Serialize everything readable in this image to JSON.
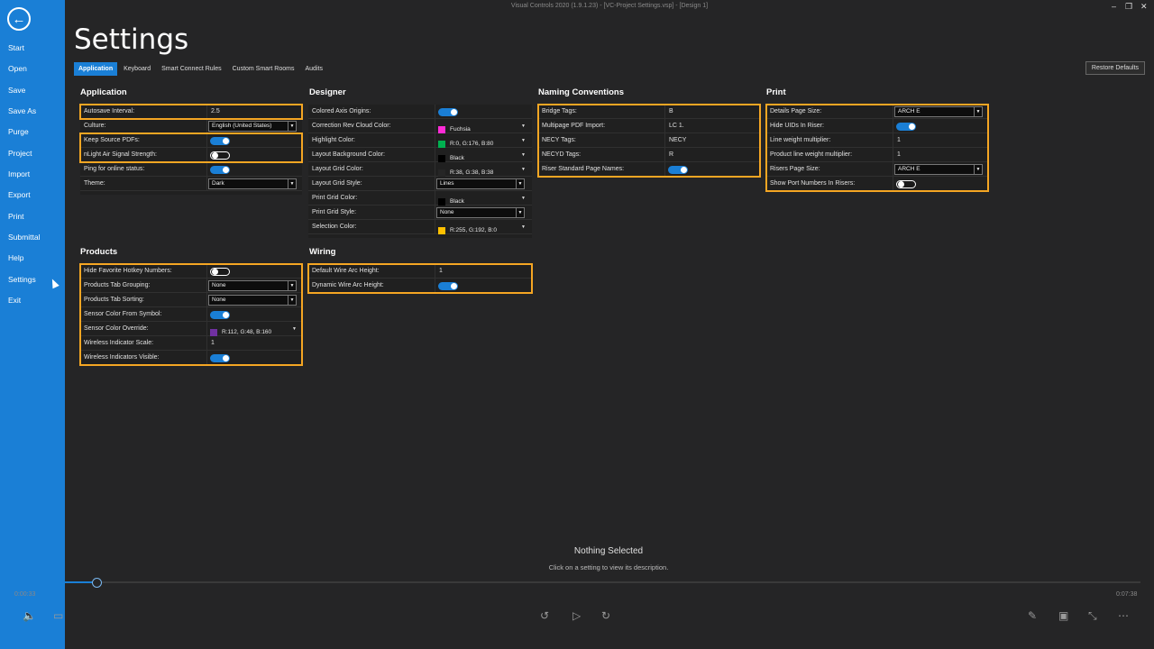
{
  "window": {
    "title": "Visual Controls 2020 (1.9.1.23) - [VC-Project Settings.vsp] - [Design 1]"
  },
  "sidebar": {
    "items": [
      "Start",
      "Open",
      "Save",
      "Save As",
      "Purge",
      "Project",
      "Import",
      "Export",
      "Print",
      "Submittal",
      "Help",
      "Settings",
      "Exit"
    ]
  },
  "page": {
    "title": "Settings"
  },
  "tabs": [
    "Application",
    "Keyboard",
    "Smart Connect Rules",
    "Custom Smart Rooms",
    "Audits"
  ],
  "restore_label": "Restore Defaults",
  "sections": {
    "application": {
      "title": "Application",
      "rows": [
        {
          "label": "Autosave Interval:",
          "value": "2.5"
        },
        {
          "label": "Culture:",
          "value": "English (United States)"
        },
        {
          "label": "Keep Source PDFs:",
          "value": ""
        },
        {
          "label": "nLight Air Signal Strength:",
          "value": ""
        },
        {
          "label": "Ping for online status:",
          "value": ""
        },
        {
          "label": "Theme:",
          "value": "Dark"
        }
      ]
    },
    "designer": {
      "title": "Designer",
      "rows": [
        {
          "label": "Colored Axis Origins:",
          "value": ""
        },
        {
          "label": "Correction Rev Cloud Color:",
          "value": "Fuchsia"
        },
        {
          "label": "Highlight Color:",
          "value": "R:0, G:176, B:80"
        },
        {
          "label": "Layout Background Color:",
          "value": "Black"
        },
        {
          "label": "Layout Grid Color:",
          "value": "R:38, G:38, B:38"
        },
        {
          "label": "Layout Grid Style:",
          "value": "Lines"
        },
        {
          "label": "Print Grid Color:",
          "value": "Black"
        },
        {
          "label": "Print Grid Style:",
          "value": "None"
        },
        {
          "label": "Selection Color:",
          "value": "R:255, G:192, B:0"
        }
      ]
    },
    "naming": {
      "title": "Naming Conventions",
      "rows": [
        {
          "label": "Bridge Tags:",
          "value": "B"
        },
        {
          "label": "Multipage PDF Import:",
          "value": "LC 1."
        },
        {
          "label": "NECY Tags:",
          "value": "NECY"
        },
        {
          "label": "NECYD Tags:",
          "value": "R"
        },
        {
          "label": "Riser Standard Page Names:",
          "value": ""
        }
      ]
    },
    "print": {
      "title": "Print",
      "rows": [
        {
          "label": "Details Page Size:",
          "value": "ARCH E"
        },
        {
          "label": "Hide UIDs In Riser:",
          "value": ""
        },
        {
          "label": "Line weight multiplier:",
          "value": "1"
        },
        {
          "label": "Product line weight multiplier:",
          "value": "1"
        },
        {
          "label": "Risers Page Size:",
          "value": "ARCH E"
        },
        {
          "label": "Show Port Numbers In Risers:",
          "value": ""
        }
      ]
    },
    "products": {
      "title": "Products",
      "rows": [
        {
          "label": "Hide Favorite Hotkey Numbers:",
          "value": ""
        },
        {
          "label": "Products Tab Grouping:",
          "value": "None"
        },
        {
          "label": "Products Tab Sorting:",
          "value": "None"
        },
        {
          "label": "Sensor Color From Symbol:",
          "value": ""
        },
        {
          "label": "Sensor Color Override:",
          "value": "R:112, G:48, B:160"
        },
        {
          "label": "Wireless Indicator Scale:",
          "value": "1"
        },
        {
          "label": "Wireless Indicators Visible:",
          "value": ""
        }
      ]
    },
    "wiring": {
      "title": "Wiring",
      "rows": [
        {
          "label": "Default Wire Arc Height:",
          "value": "1"
        },
        {
          "label": "Dynamic Wire Arc Height:",
          "value": ""
        }
      ]
    }
  },
  "status": {
    "title": "Nothing Selected",
    "description": "Click on a setting to view its description."
  },
  "player": {
    "elapsed": "0:00:33",
    "total": "0:07:38",
    "progress_fraction": 0.072
  },
  "colors": {
    "accent": "#1a7fd6",
    "highlight_box": "#f5a623",
    "fuchsia": "#ff2bd6",
    "green": "#00b050",
    "selection": "#ffc000",
    "purple": "#7030a0",
    "grid": "#262626",
    "black": "#000000"
  }
}
